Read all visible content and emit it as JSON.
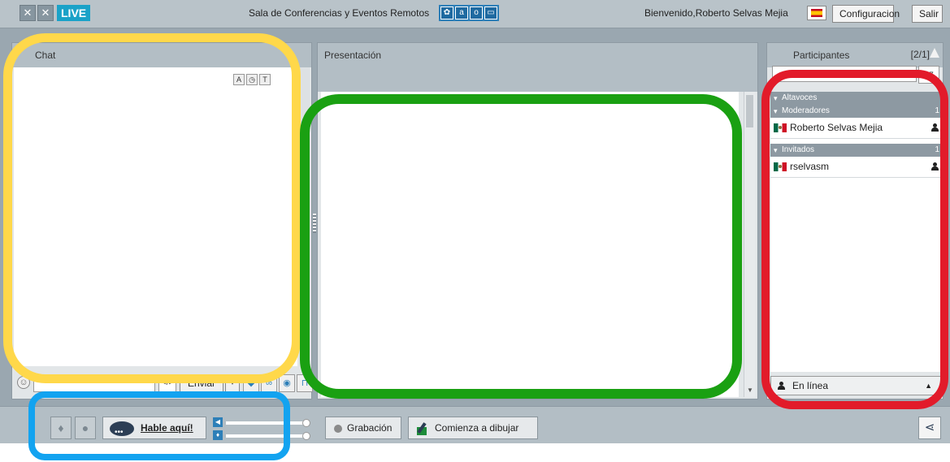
{
  "header": {
    "live_label": "LIVE",
    "room_title": "Sala de Conferencias y Eventos Remotos",
    "welcome": "Bienvenido,Roberto Selvas Mejia",
    "config_button": "Configuracion",
    "exit_button": "Salir",
    "language_flag": "spain-flag-icon"
  },
  "chat": {
    "title": "Chat",
    "send_label": "Enviar",
    "code_label": "</>",
    "tool_icons": [
      "font-color-icon",
      "clock-icon",
      "font-size-icon"
    ]
  },
  "presentation": {
    "title": "Presentación"
  },
  "participants": {
    "title": "Participantes",
    "count": "[2/1]",
    "sort_label": "AZ",
    "groups": [
      {
        "name": "Altavoces",
        "count": "",
        "members": []
      },
      {
        "name": "Moderadores",
        "count": "1",
        "members": [
          "Roberto Selvas Mejia"
        ]
      },
      {
        "name": "Invitados",
        "count": "1",
        "members": [
          "rselvasm"
        ]
      }
    ],
    "status": "En línea"
  },
  "bottom": {
    "talk_label": "Hable aquí!",
    "record_label": "Grabación",
    "draw_label": "Comienza a dibujar"
  },
  "annotation_colors": {
    "chat_ring": "#ffd84a",
    "presentation_ring": "#1aa012",
    "participants_ring": "#e21b2a",
    "media_ring": "#13a3f0"
  }
}
